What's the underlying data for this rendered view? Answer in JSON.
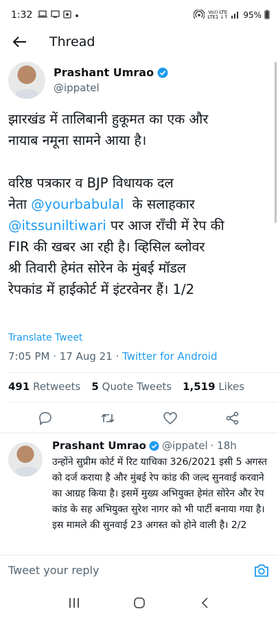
{
  "status_bar": {
    "time": "1:32",
    "network_label": "Vo)) LTE\nLTE1 ↓↑",
    "battery": "95%"
  },
  "header": {
    "title": "Thread"
  },
  "tweet": {
    "author_name": "Prashant Umrao",
    "author_handle": "@ippatel",
    "line1": "झारखंड में तालिबानी हुकूमत का एक और",
    "line2": "नायाब नमूना सामने आया है।",
    "line3": "वरिष्ठ पत्रकार व BJP विधायक दल",
    "line4_pre": "नेता ",
    "mention1": "@yourbabulal",
    "line4_post": "  के सलाहकार",
    "mention2": "@itssuniltiwari",
    "line5_post": " पर आज राँची में रेप की",
    "line6": "FIR की खबर आ रही है। व्हिसिल ब्लोवर",
    "line7": "श्री तिवारी हेमंत सोरेन के मुंबई मॉडल",
    "line8": "रेपकांड में हाईकोर्ट में इंटरवेनर हैं। 1/2",
    "translate": "Translate Tweet",
    "time_date": "7:05 PM · 17 Aug 21 · ",
    "source": "Twitter for Android",
    "retweets_count": "491",
    "retweets_label": "Retweets",
    "quotes_count": "5",
    "quotes_label": "Quote Tweets",
    "likes_count": "1,519",
    "likes_label": "Likes"
  },
  "reply_tweet": {
    "author_name": "Prashant Umrao",
    "author_handle": "@ippatel",
    "age": "· 18h",
    "text": "उन्होंने सुप्रीम कोर्ट में रिट याचिका 326/2021 इसी 5 अगस्त को दर्ज कराया है और मुंबई रेप कांड की जल्द सुनवाई करवाने का आग्रह किया है। इसमें मुख्य अभियुक्त हेमंत सोरेन और रेप कांड के सह अभियुक्त सुरेश नागर को भी पार्टी बनाया गया है। इस मामले की सुनवाई 23 अगस्त को होने वाली है। 2/2"
  },
  "composer": {
    "placeholder": "Tweet your reply"
  },
  "colors": {
    "accent": "#1d9bf0",
    "secondary_text": "#536471",
    "primary_text": "#0f1419"
  }
}
